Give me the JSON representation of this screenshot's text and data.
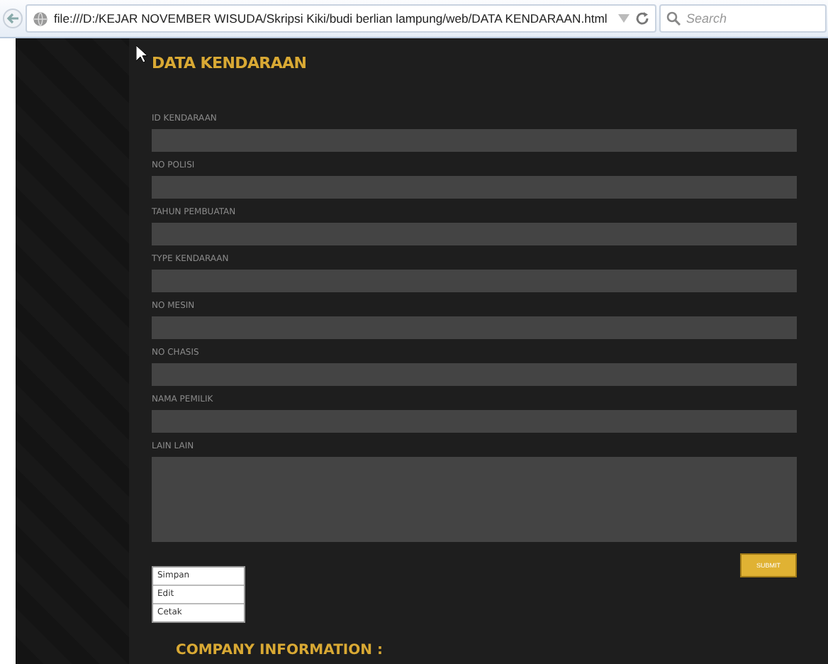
{
  "browser": {
    "url": "file:///D:/KEJAR NOVEMBER WISUDA/Skripsi Kiki/budi berlian lampung/web/DATA KENDARAAN.html",
    "search_placeholder": "Search"
  },
  "page": {
    "title": "DATA KENDARAAN",
    "fields": [
      {
        "label": "ID KENDARAAN",
        "kind": "input"
      },
      {
        "label": "NO POLISI",
        "kind": "input"
      },
      {
        "label": "TAHUN PEMBUATAN",
        "kind": "input"
      },
      {
        "label": "TYPE KENDARAAN",
        "kind": "input"
      },
      {
        "label": "NO MESIN",
        "kind": "input"
      },
      {
        "label": "NO CHASIS",
        "kind": "input"
      },
      {
        "label": "NAMA PEMILIK",
        "kind": "input"
      },
      {
        "label": "LAIN LAIN",
        "kind": "textarea"
      }
    ],
    "submit": "SUBMIT",
    "options": [
      {
        "label": "Simpan",
        "selected": false
      },
      {
        "label": "Edit",
        "selected": false
      },
      {
        "label": "Cetak",
        "selected": false
      }
    ],
    "footer_heading": "COMPANY INFORMATION :"
  }
}
